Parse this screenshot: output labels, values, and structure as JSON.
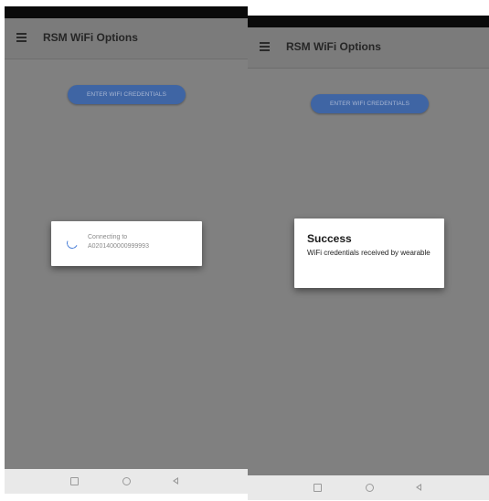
{
  "left_screen": {
    "app_bar": {
      "title": "RSM WiFi Options",
      "menu_icon": "hamburger-menu-icon"
    },
    "wifi_button_label": "ENTER WIFI CREDENTIALS",
    "connecting_dialog": {
      "spinner_icon": "loading-spinner-icon",
      "line1": "Connecting to",
      "line2": "A0201400000999993"
    },
    "nav_bar": {
      "icons": [
        "recent-apps-icon",
        "home-icon",
        "back-icon"
      ]
    }
  },
  "right_screen": {
    "app_bar": {
      "title": "RSM WiFi Options",
      "menu_icon": "hamburger-menu-icon"
    },
    "wifi_button_label": "ENTER WIFI CREDENTIALS",
    "success_dialog": {
      "title": "Success",
      "message": "WiFi credentials received by wearable"
    },
    "nav_bar": {
      "icons": [
        "recent-apps-icon",
        "home-icon",
        "back-icon"
      ]
    }
  },
  "colors": {
    "overlay_gray": "#808080",
    "button_blue": "#3f65a4",
    "spinner_blue": "#4a7fd8",
    "dialog_white": "#ffffff",
    "nav_bar": "#e9e9e9"
  }
}
